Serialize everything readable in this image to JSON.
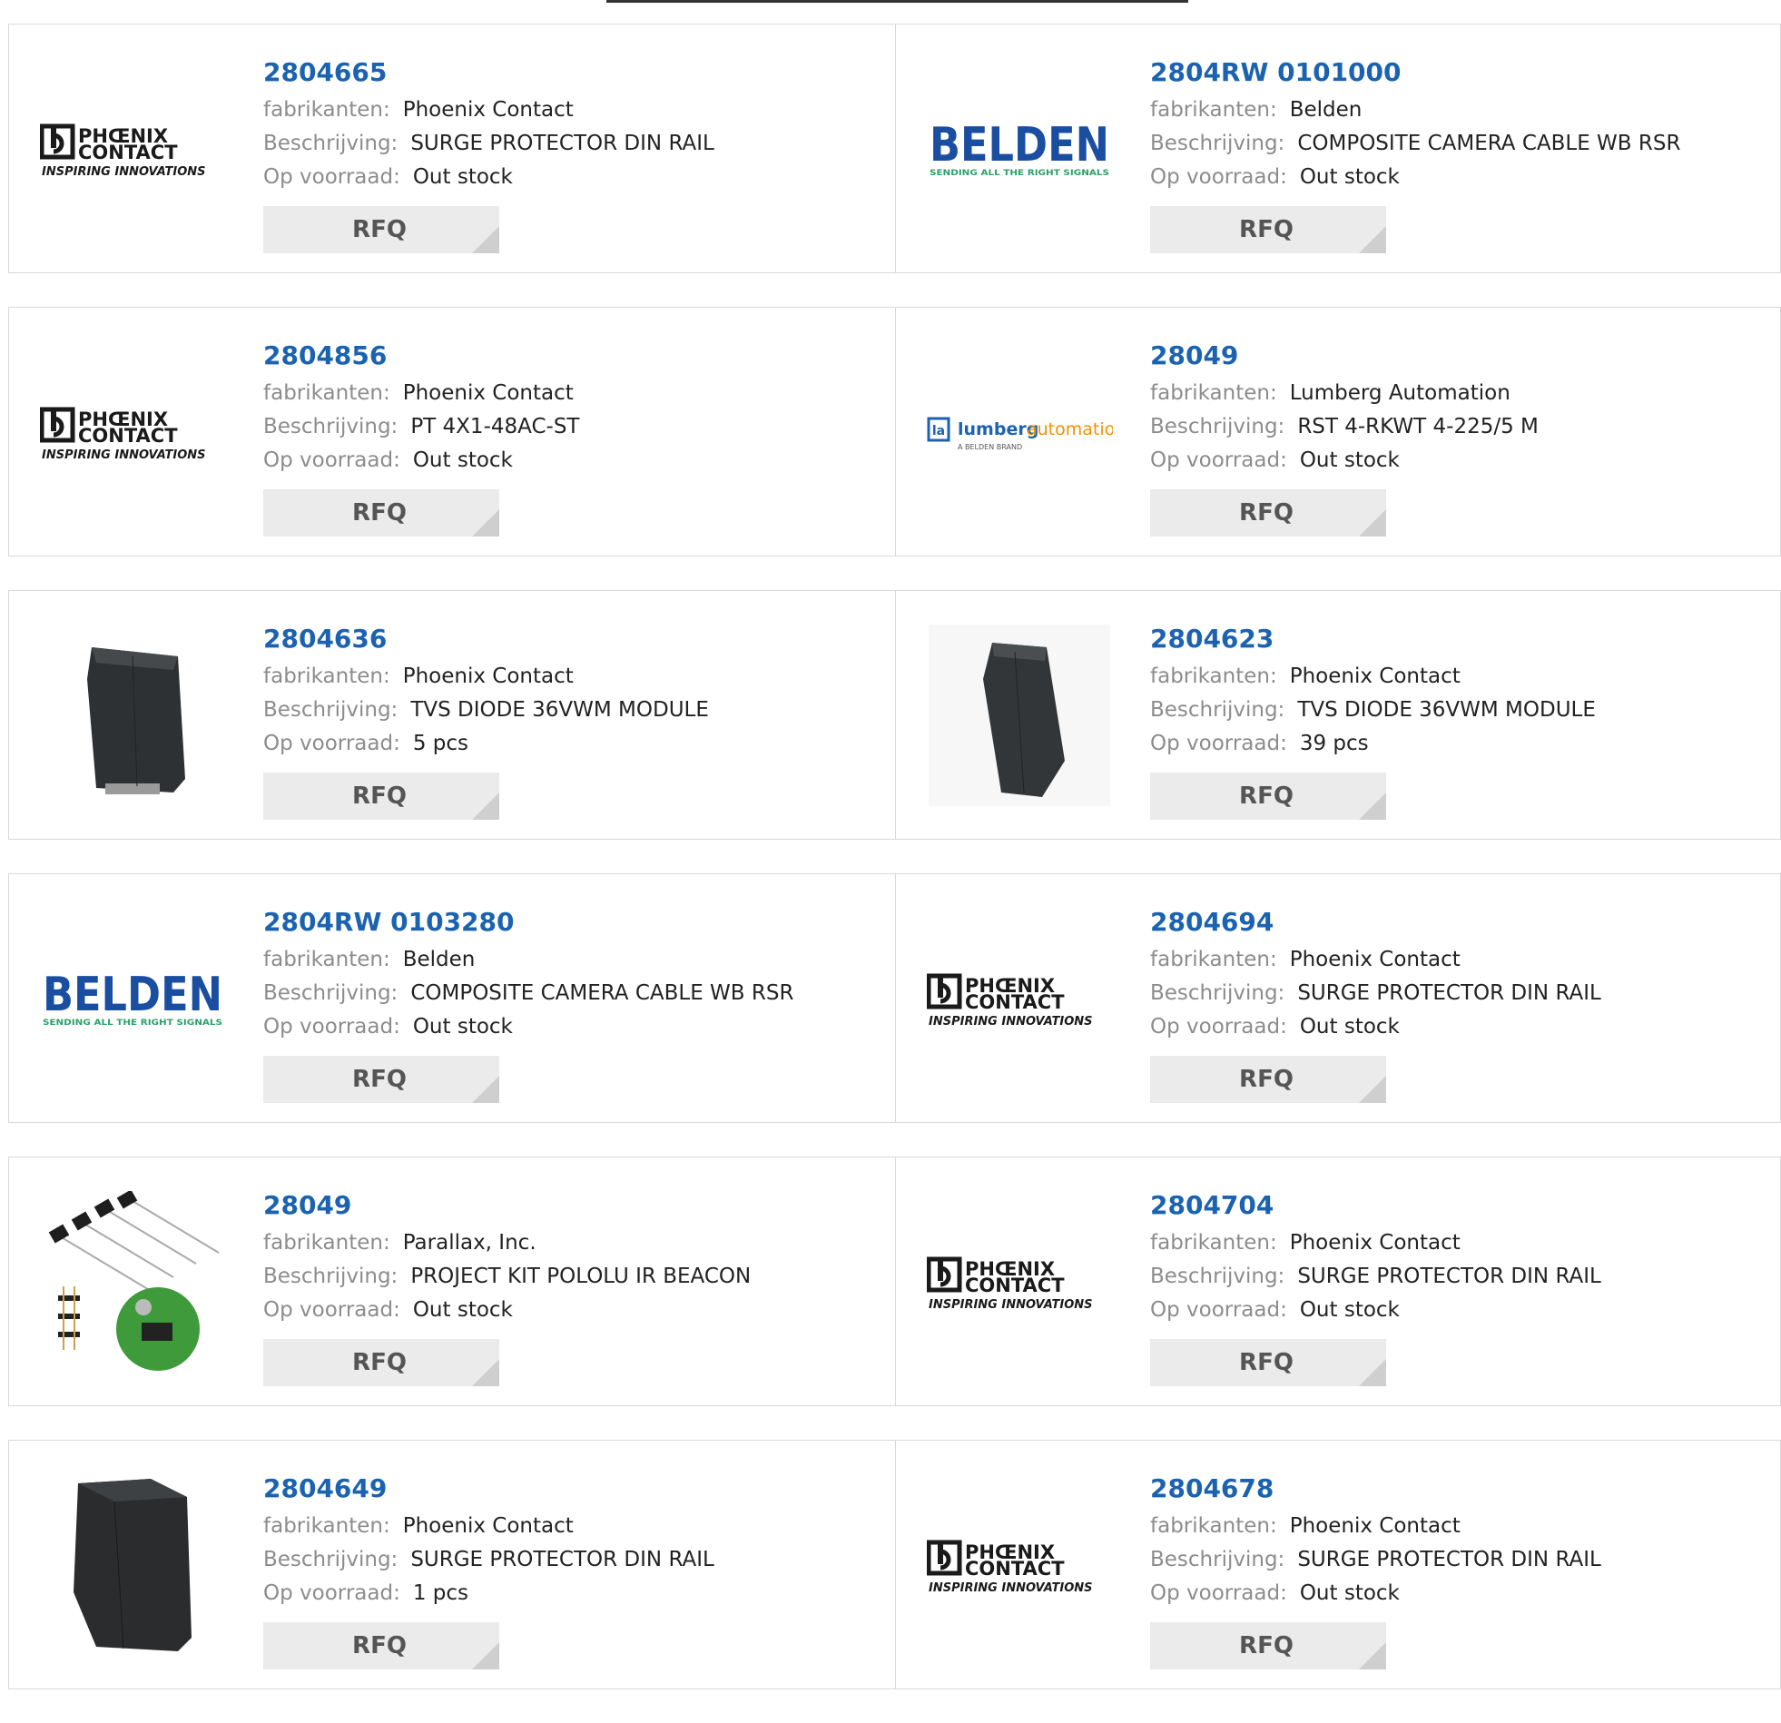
{
  "rfq_label": "RFQ",
  "labels": {
    "manufacturer": "fabrikanten:",
    "description": "Beschrijving:",
    "stock": "Op voorraad:"
  },
  "colors": {
    "link": "#1b63b0",
    "label": "#8c8c8c",
    "rfq_bg": "#ebebeb",
    "phoenix_text": "#1a1a1a",
    "belden_blue": "#1a4ea1",
    "belden_green": "#2aa06a",
    "lumberg_blue": "#1b63b0",
    "lumberg_orange": "#f39200"
  },
  "logo_text": {
    "phoenix_line1": "PHŒNIX",
    "phoenix_line2": "CONTACT",
    "phoenix_tagline": "INSPIRING INNOVATIONS",
    "belden_name": "BELDEN",
    "belden_tagline": "SENDING ALL THE RIGHT SIGNALS",
    "lumberg_part1": "lumberg",
    "lumberg_part2": "automation",
    "lumberg_tagline": "A BELDEN BRAND"
  },
  "products": [
    {
      "part": "2804665",
      "manufacturer": "Phoenix Contact",
      "description": "SURGE PROTECTOR DIN RAIL",
      "stock": "Out stock",
      "image": "phoenix-contact-logo"
    },
    {
      "part": "2804RW 0101000",
      "manufacturer": "Belden",
      "description": "COMPOSITE CAMERA CABLE WB RSR",
      "stock": "Out stock",
      "image": "belden-logo"
    },
    {
      "part": "2804856",
      "manufacturer": "Phoenix Contact",
      "description": "PT 4X1-48AC-ST",
      "stock": "Out stock",
      "image": "phoenix-contact-logo"
    },
    {
      "part": "28049",
      "manufacturer": "Lumberg Automation",
      "description": "RST 4-RKWT 4-225/5 M",
      "stock": "Out stock",
      "image": "lumberg-automation-logo"
    },
    {
      "part": "2804636",
      "manufacturer": "Phoenix Contact",
      "description": "TVS DIODE 36VWM MODULE",
      "stock": "5 pcs",
      "image": "din-rail-module-photo"
    },
    {
      "part": "2804623",
      "manufacturer": "Phoenix Contact",
      "description": "TVS DIODE 36VWM MODULE",
      "stock": "39 pcs",
      "image": "din-rail-module-photo"
    },
    {
      "part": "2804RW 0103280",
      "manufacturer": "Belden",
      "description": "COMPOSITE CAMERA CABLE WB RSR",
      "stock": "Out stock",
      "image": "belden-logo"
    },
    {
      "part": "2804694",
      "manufacturer": "Phoenix Contact",
      "description": "SURGE PROTECTOR DIN RAIL",
      "stock": "Out stock",
      "image": "phoenix-contact-logo"
    },
    {
      "part": "28049",
      "manufacturer": "Parallax, Inc.",
      "description": "PROJECT KIT POLOLU IR BEACON",
      "stock": "Out stock",
      "image": "ir-beacon-kit-photo"
    },
    {
      "part": "2804704",
      "manufacturer": "Phoenix Contact",
      "description": "SURGE PROTECTOR DIN RAIL",
      "stock": "Out stock",
      "image": "phoenix-contact-logo"
    },
    {
      "part": "2804649",
      "manufacturer": "Phoenix Contact",
      "description": "SURGE PROTECTOR DIN RAIL",
      "stock": "1 pcs",
      "image": "surge-protector-photo"
    },
    {
      "part": "2804678",
      "manufacturer": "Phoenix Contact",
      "description": "SURGE PROTECTOR DIN RAIL",
      "stock": "Out stock",
      "image": "phoenix-contact-logo"
    }
  ]
}
